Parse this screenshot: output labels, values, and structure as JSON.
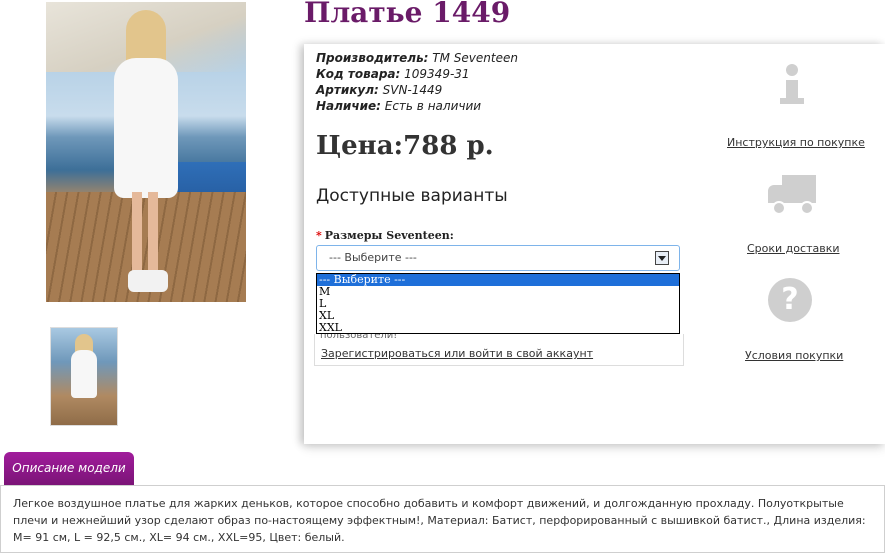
{
  "product": {
    "title": "Платье 1449",
    "attributes": [
      {
        "label": "Производитель:",
        "value": "TM Seventeen"
      },
      {
        "label": "Код товара:",
        "value": "109349-31"
      },
      {
        "label": "Артикул:",
        "value": "SVN-1449"
      },
      {
        "label": "Наличие:",
        "value": "Есть в наличии"
      }
    ],
    "price": "Цена:788 р.",
    "variants_title": "Доступные варианты"
  },
  "size_select": {
    "label": "Размеры Seventeen:",
    "required_mark": "*",
    "selected": "--- Выберите ---",
    "options": [
      "--- Выберите ---",
      "M",
      "L",
      "XL",
      "XXL"
    ]
  },
  "login": {
    "partial_text": "пользователи!",
    "register_link": "Зарегистрироваться или войти в свой аккаунт"
  },
  "side_links": {
    "instructions": "Инструкция по покупке",
    "delivery": "Сроки доставки",
    "terms": "Условия покупки",
    "question_glyph": "?"
  },
  "icons": [
    "info-icon",
    "truck-icon",
    "question-icon"
  ],
  "description": {
    "tab_label": "Описание модели",
    "text": "Легкое воздушное платье для жарких деньков, которое способно добавить и комфорт движений, и долгожданную прохладу. Полуоткрытые плечи и нежнейший узор сделают образ по-настоящему эффектным!, Материал: Батист, перфорированный с вышивкой батист., Длина изделия: M= 91 см, L = 92,5 см., XL= 94 см., XXL=95, Цвет: белый."
  },
  "colors": {
    "title": "#6a1b68",
    "tab": "#8f1a8a",
    "select_border": "#7eb4ea",
    "option_selected": "#1e6fd9",
    "icon_gray": "#cfcfcf"
  }
}
